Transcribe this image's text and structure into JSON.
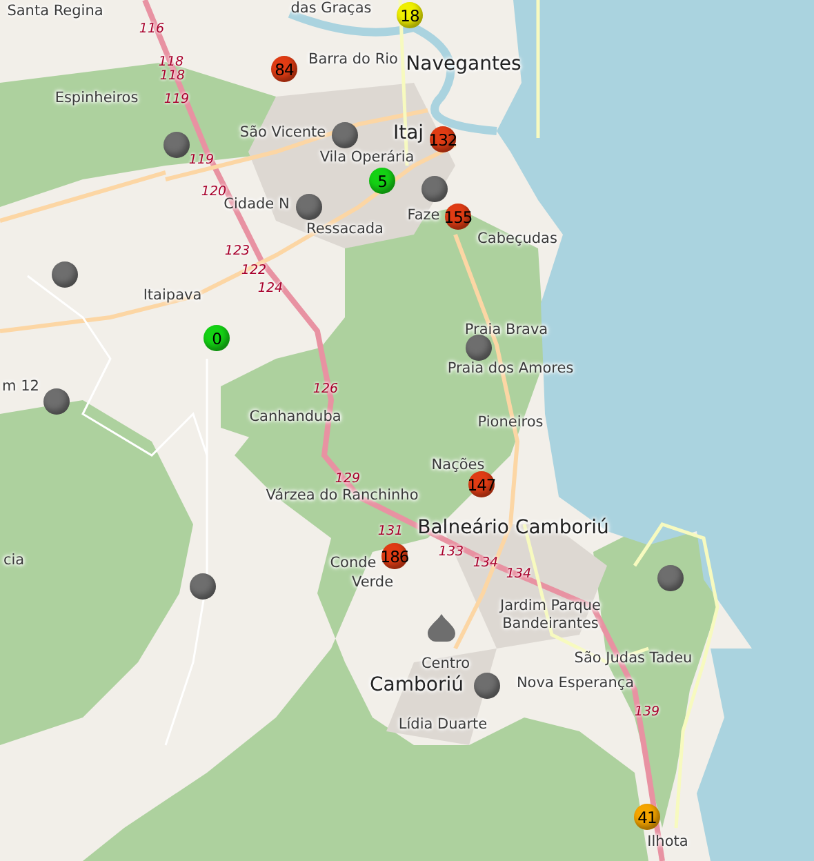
{
  "map": {
    "places": [
      {
        "name": "Santa Regina",
        "kind": "small"
      },
      {
        "name": "das Graças",
        "kind": "small"
      },
      {
        "name": "Barra do Rio",
        "kind": "small"
      },
      {
        "name": "Navegantes",
        "kind": "town"
      },
      {
        "name": "Espinheiros",
        "kind": "small"
      },
      {
        "name": "São Vicente",
        "kind": "small"
      },
      {
        "name": "Itaj",
        "kind": "town"
      },
      {
        "name": "Vila Operária",
        "kind": "small"
      },
      {
        "name": "Cidade N",
        "kind": "small"
      },
      {
        "name": "Faze",
        "kind": "small"
      },
      {
        "name": "Ressacada",
        "kind": "small"
      },
      {
        "name": "Cabeçudas",
        "kind": "small"
      },
      {
        "name": "Itaipava",
        "kind": "small"
      },
      {
        "name": "Praia Brava",
        "kind": "small"
      },
      {
        "name": "Praia dos Amores",
        "kind": "small"
      },
      {
        "name": "m 12",
        "kind": "small"
      },
      {
        "name": "Canhanduba",
        "kind": "small"
      },
      {
        "name": "Pioneiros",
        "kind": "small"
      },
      {
        "name": "Nações",
        "kind": "small"
      },
      {
        "name": "Várzea do Ranchinho",
        "kind": "small"
      },
      {
        "name": "Balneário Camboriú",
        "kind": "town"
      },
      {
        "name": "cia",
        "kind": "small"
      },
      {
        "name": "Conde",
        "kind": "small"
      },
      {
        "name": "Verde",
        "kind": "small"
      },
      {
        "name": "Jardim Parque",
        "kind": "small"
      },
      {
        "name": "Bandeirantes",
        "kind": "small"
      },
      {
        "name": "Centro",
        "kind": "small"
      },
      {
        "name": "São Judas Tadeu",
        "kind": "small"
      },
      {
        "name": "Camboriú",
        "kind": "town"
      },
      {
        "name": "Nova Esperança",
        "kind": "small"
      },
      {
        "name": "Lídia Duarte",
        "kind": "small"
      },
      {
        "name": "Ilhota",
        "kind": "small"
      }
    ],
    "road_numbers": [
      "116",
      "118",
      "118",
      "119",
      "119",
      "120",
      "123",
      "122",
      "124",
      "126",
      "129",
      "131",
      "133",
      "134",
      "134",
      "139"
    ],
    "markers": [
      {
        "kind": "circle",
        "label": "18",
        "color": "#f0f000"
      },
      {
        "kind": "circle",
        "label": "84",
        "color": "#e03c14"
      },
      {
        "kind": "circle",
        "color": "#6e6e6e"
      },
      {
        "kind": "circle",
        "color": "#6e6e6e"
      },
      {
        "kind": "circle",
        "label": "132",
        "color": "#e03c14"
      },
      {
        "kind": "circle",
        "label": "5",
        "color": "#14d214"
      },
      {
        "kind": "circle",
        "color": "#6e6e6e"
      },
      {
        "kind": "circle",
        "color": "#6e6e6e"
      },
      {
        "kind": "circle",
        "label": "155",
        "color": "#e03c14"
      },
      {
        "kind": "circle",
        "color": "#6e6e6e"
      },
      {
        "kind": "circle",
        "label": "0",
        "color": "#14d214"
      },
      {
        "kind": "circle",
        "color": "#6e6e6e"
      },
      {
        "kind": "circle",
        "color": "#6e6e6e"
      },
      {
        "kind": "circle",
        "label": "147",
        "color": "#e03c14"
      },
      {
        "kind": "circle",
        "label": "186",
        "color": "#e03c14"
      },
      {
        "kind": "circle",
        "color": "#6e6e6e"
      },
      {
        "kind": "circle",
        "color": "#6e6e6e"
      },
      {
        "kind": "drop",
        "color": "#6e6e6e"
      },
      {
        "kind": "circle",
        "color": "#6e6e6e"
      },
      {
        "kind": "circle",
        "label": "41",
        "color": "#f5a500"
      }
    ]
  }
}
